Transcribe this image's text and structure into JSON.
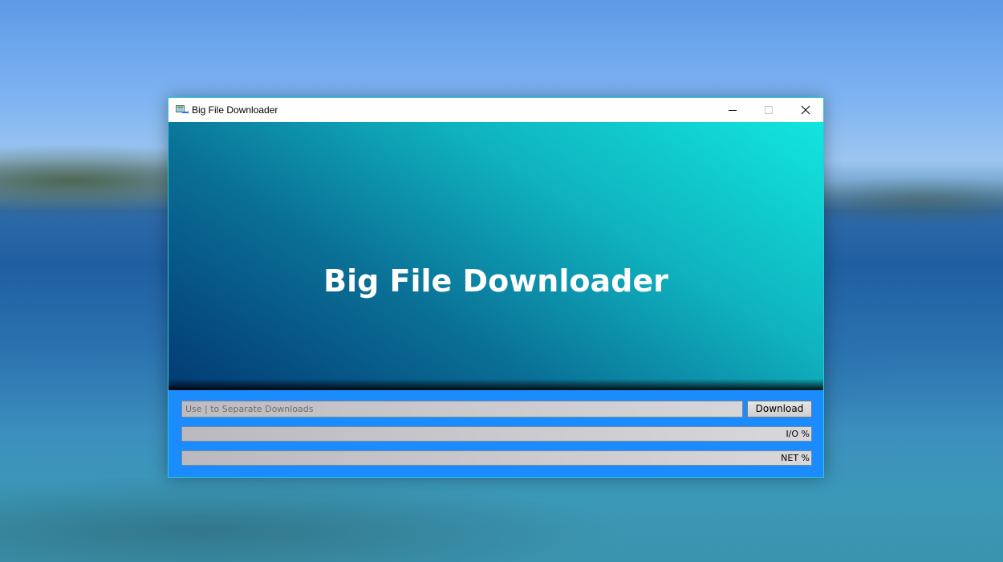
{
  "window": {
    "title": "Big File Downloader",
    "app_icon": "downloader-app-icon",
    "controls": {
      "minimize_icon": "minimize-icon",
      "maximize_icon": "maximize-icon",
      "close_icon": "close-icon"
    }
  },
  "banner": {
    "title": "Big File Downloader"
  },
  "download_form": {
    "url_placeholder": "Use | to Separate Downloads",
    "url_value": "",
    "download_label": "Download"
  },
  "progress": {
    "io": {
      "label": "I/O %",
      "value": 0
    },
    "net": {
      "label": "NET %",
      "value": 0
    }
  },
  "colors": {
    "window_accent": "#2bc9d6",
    "panel_background": "#1a8cff",
    "banner_gradient_start": "#033a73",
    "banner_gradient_end": "#12e6de",
    "progress_fill": "#06b025"
  }
}
